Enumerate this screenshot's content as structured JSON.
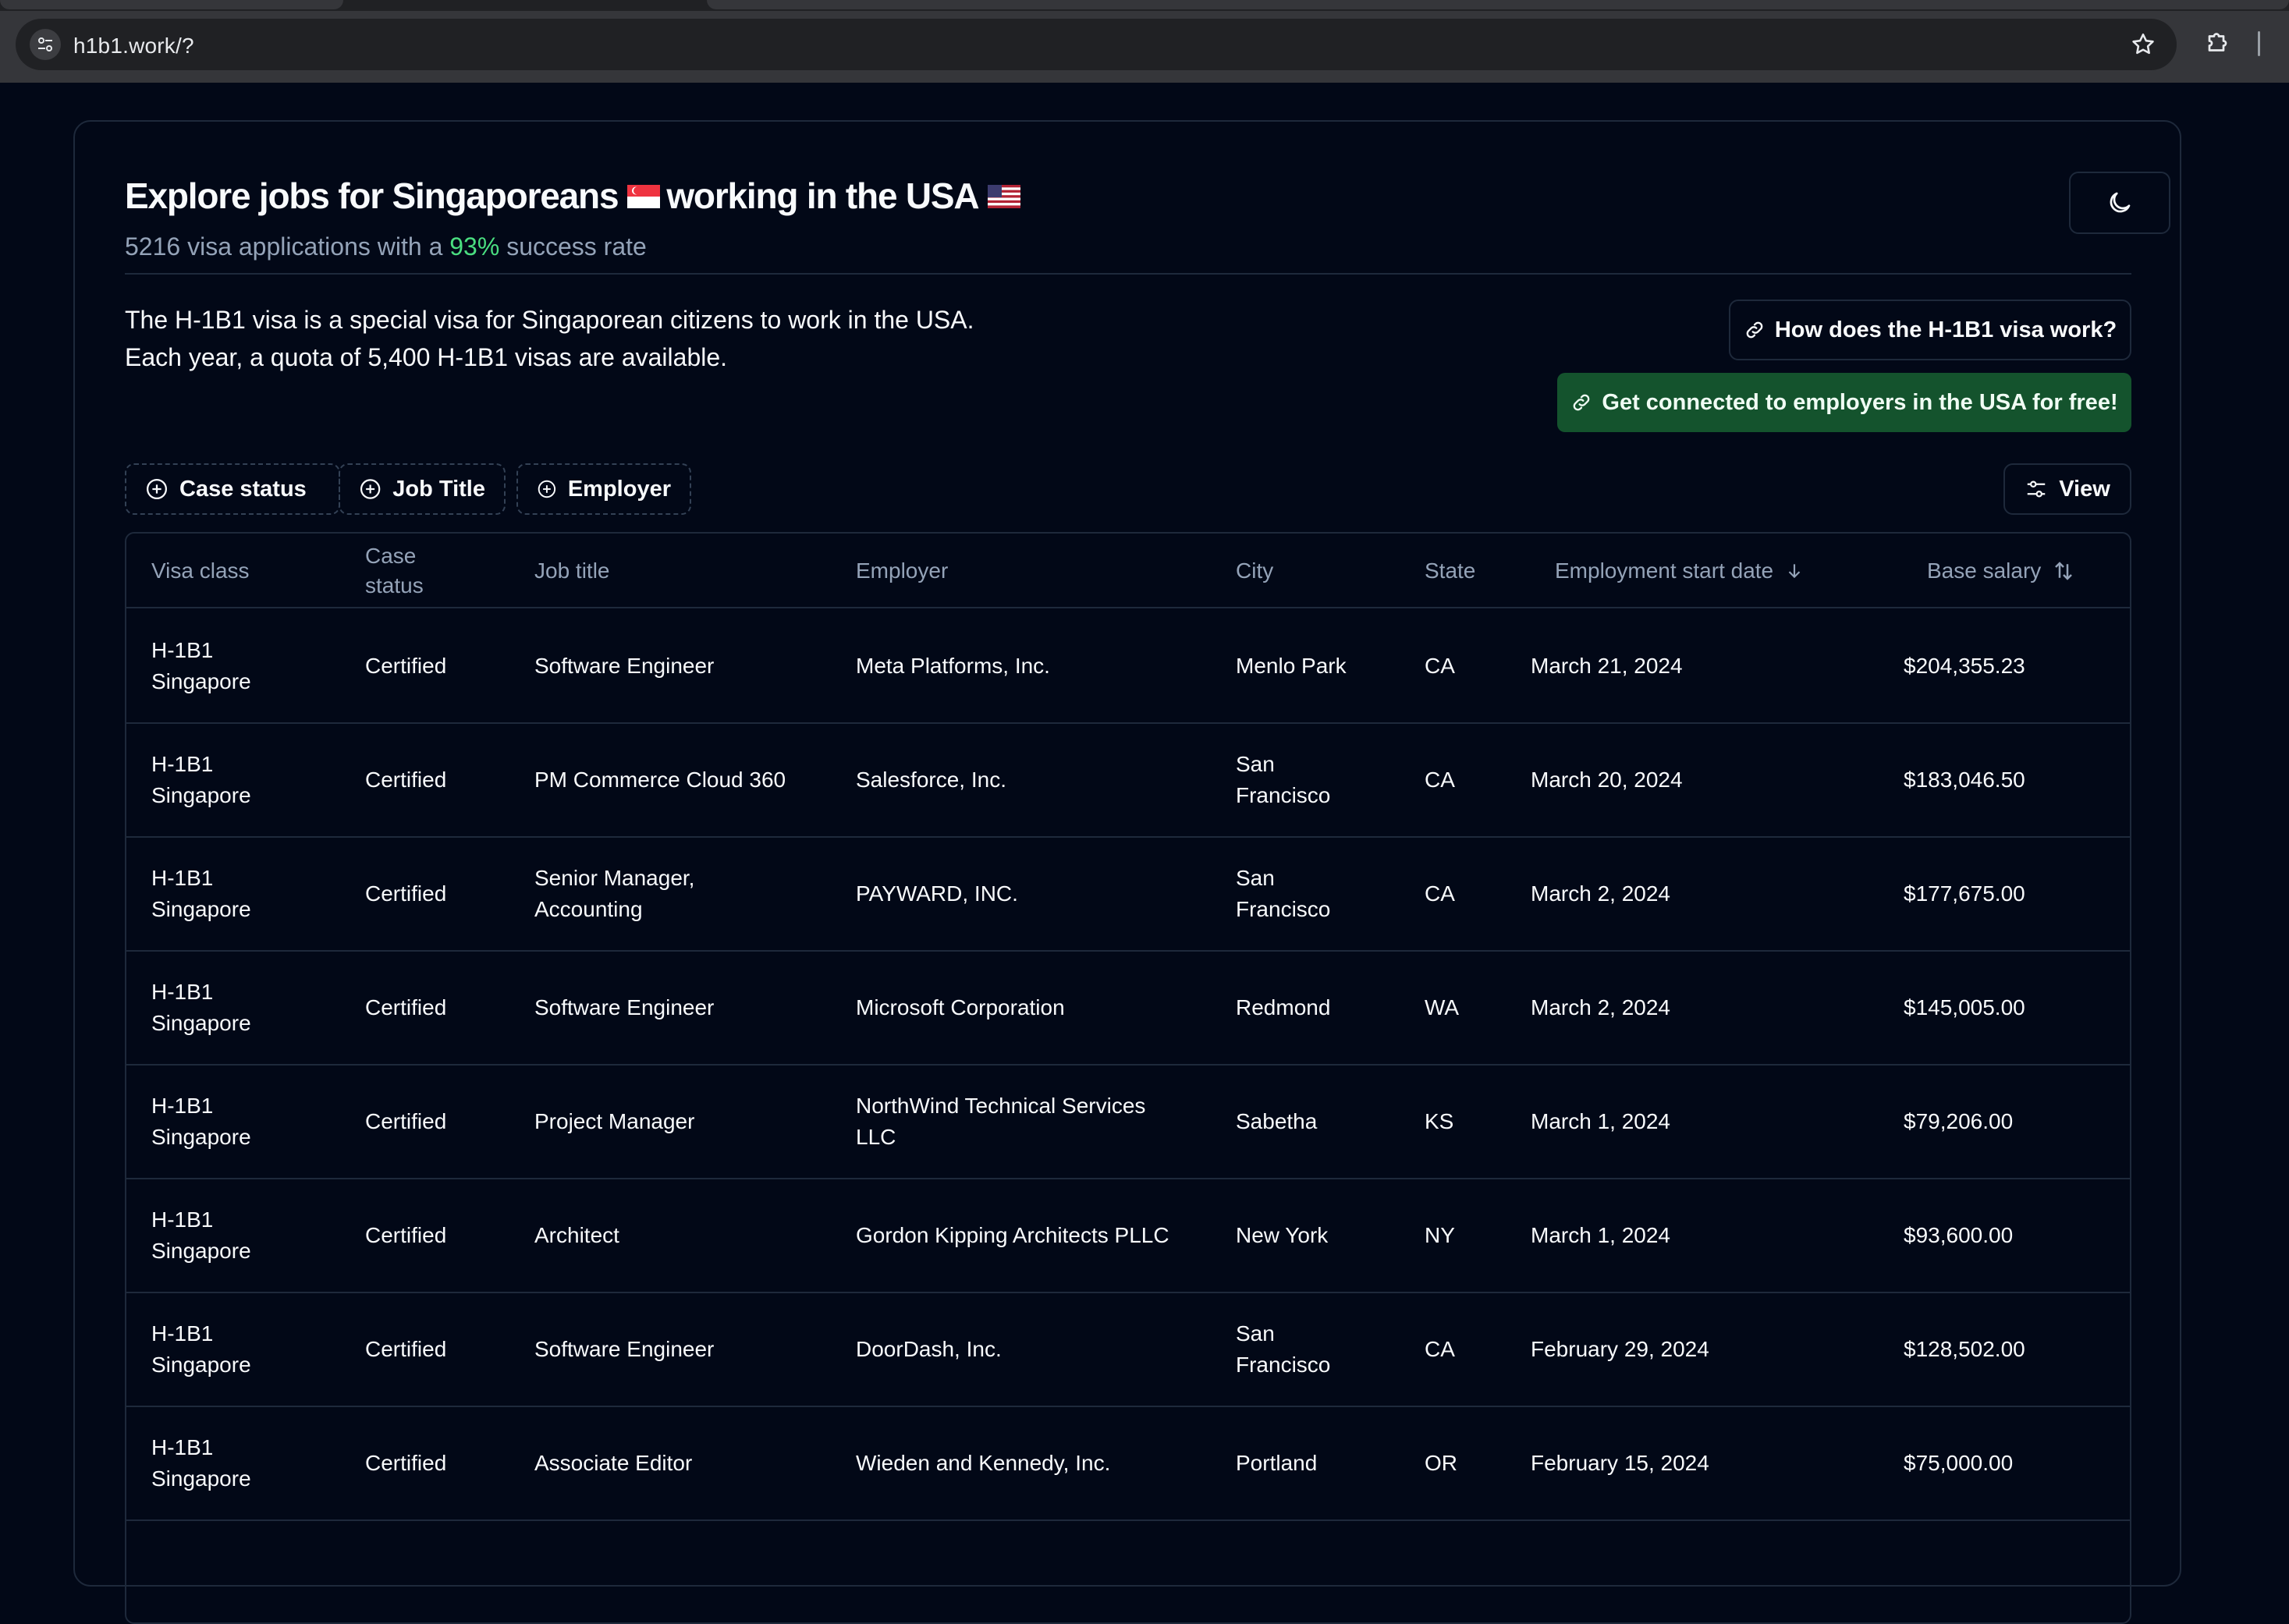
{
  "browser": {
    "url": "h1b1.work/?"
  },
  "header": {
    "title_part1": "Explore jobs for Singaporeans",
    "title_part2": "working in the USA",
    "subtitle_count": "5216 visa applications with a",
    "subtitle_rate": "93%",
    "subtitle_suffix": "success rate"
  },
  "intro": {
    "line1": "The H-1B1 visa is a special visa for Singaporean citizens to work in the USA.",
    "line2": "Each year, a quota of 5,400 H-1B1 visas are available."
  },
  "actions": {
    "how_label": "How does the H-1B1 visa work?",
    "connect_label": "Get connected to employers in the USA for free!",
    "view_label": "View"
  },
  "filters": {
    "case_status": "Case status",
    "job_title": "Job Title",
    "employer": "Employer"
  },
  "table": {
    "columns": {
      "visa_class": "Visa class",
      "case_status_1": "Case",
      "case_status_2": "status",
      "job_title": "Job title",
      "employer": "Employer",
      "city": "City",
      "state": "State",
      "start_date": "Employment start date",
      "salary": "Base salary"
    },
    "rows": [
      {
        "visa1": "H-1B1",
        "visa2": "Singapore",
        "status": "Certified",
        "job1": "Software Engineer",
        "job2": "",
        "emp1": "Meta Platforms, Inc.",
        "emp2": "",
        "city1": "Menlo Park",
        "city2": "",
        "state": "CA",
        "date": "March 21, 2024",
        "salary": "$204,355.23"
      },
      {
        "visa1": "H-1B1",
        "visa2": "Singapore",
        "status": "Certified",
        "job1": "PM Commerce Cloud 360",
        "job2": "",
        "emp1": "Salesforce, Inc.",
        "emp2": "",
        "city1": "San",
        "city2": "Francisco",
        "state": "CA",
        "date": "March 20, 2024",
        "salary": "$183,046.50"
      },
      {
        "visa1": "H-1B1",
        "visa2": "Singapore",
        "status": "Certified",
        "job1": "Senior Manager,",
        "job2": "Accounting",
        "emp1": "PAYWARD, INC.",
        "emp2": "",
        "city1": "San",
        "city2": "Francisco",
        "state": "CA",
        "date": "March 2, 2024",
        "salary": "$177,675.00"
      },
      {
        "visa1": "H-1B1",
        "visa2": "Singapore",
        "status": "Certified",
        "job1": "Software Engineer",
        "job2": "",
        "emp1": "Microsoft Corporation",
        "emp2": "",
        "city1": "Redmond",
        "city2": "",
        "state": "WA",
        "date": "March 2, 2024",
        "salary": "$145,005.00"
      },
      {
        "visa1": "H-1B1",
        "visa2": "Singapore",
        "status": "Certified",
        "job1": "Project Manager",
        "job2": "",
        "emp1": "NorthWind Technical Services",
        "emp2": "LLC",
        "city1": "Sabetha",
        "city2": "",
        "state": "KS",
        "date": "March 1, 2024",
        "salary": "$79,206.00"
      },
      {
        "visa1": "H-1B1",
        "visa2": "Singapore",
        "status": "Certified",
        "job1": "Architect",
        "job2": "",
        "emp1": "Gordon Kipping Architects PLLC",
        "emp2": "",
        "city1": "New York",
        "city2": "",
        "state": "NY",
        "date": "March 1, 2024",
        "salary": "$93,600.00"
      },
      {
        "visa1": "H-1B1",
        "visa2": "Singapore",
        "status": "Certified",
        "job1": "Software Engineer",
        "job2": "",
        "emp1": "DoorDash, Inc.",
        "emp2": "",
        "city1": "San",
        "city2": "Francisco",
        "state": "CA",
        "date": "February 29, 2024",
        "salary": "$128,502.00"
      },
      {
        "visa1": "H-1B1",
        "visa2": "Singapore",
        "status": "Certified",
        "job1": "Associate Editor",
        "job2": "",
        "emp1": "Wieden and Kennedy, Inc.",
        "emp2": "",
        "city1": "Portland",
        "city2": "",
        "state": "OR",
        "date": "February 15, 2024",
        "salary": "$75,000.00"
      }
    ]
  },
  "icons": {
    "site_settings": "tune-icon",
    "bookmark": "star-icon",
    "extensions": "puzzle-icon",
    "theme": "moon-icon",
    "link": "link-icon",
    "filter_add": "plus-circle-icon",
    "view": "sliders-icon",
    "sort_desc": "arrow-down-icon",
    "sort_both": "arrow-up-down-icon",
    "flag_sg": "singapore-flag-icon",
    "flag_us": "us-flag-icon"
  },
  "colors": {
    "background": "#020817",
    "border": "#1e293b",
    "muted_text": "#94a3b8",
    "success": "#4ade80",
    "cta_green": "#14532d"
  }
}
